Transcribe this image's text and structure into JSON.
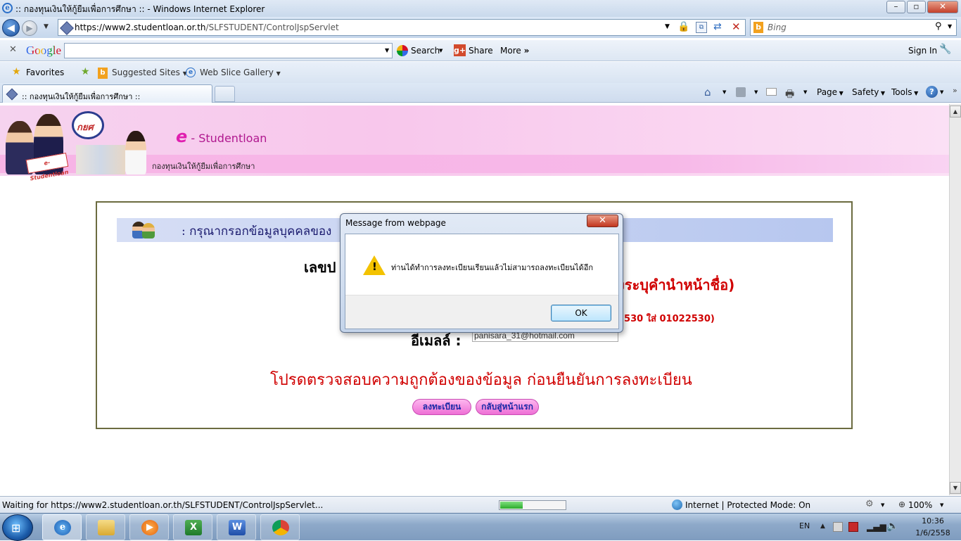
{
  "window": {
    "title": ":: กองทุนเงินให้กู้ยืมเพื่อการศึกษา :: - Windows Internet Explorer"
  },
  "address_bar": {
    "url_domain": "https://www2.studentloan.or.th",
    "url_path": "/SLFSTUDENT/ControlJspServlet",
    "search_placeholder": "Bing"
  },
  "google_toolbar": {
    "logo": "Google",
    "search_label": "Search",
    "share_label": "Share",
    "more_label": "More",
    "signin_label": "Sign In"
  },
  "favorites_bar": {
    "favorites_label": "Favorites",
    "items": [
      "Suggested Sites",
      "Web Slice Gallery"
    ]
  },
  "tabs": [
    {
      "label": ":: กองทุนเงินให้กู้ยืมเพื่อการศึกษา ::"
    }
  ],
  "command_bar": {
    "page": "Page",
    "safety": "Safety",
    "tools": "Tools"
  },
  "banner": {
    "logo_text": "กยศ",
    "title_e": "e",
    "title_rest": "- Studentloan",
    "subtitle": "กองทุนเงินให้กู้ยืมเพื่อการศึกษา",
    "badge": "e-Studentloan"
  },
  "form": {
    "header": ": กรุณากรอกข้อมูลบุคคลของ",
    "id_label_partial": "เลขป",
    "name_hint_partial": "งระบุคำนำหน้าชื่อ)",
    "birthdate_hint_partial": "2530 ใส่ 01022530)",
    "email_label": "อีเมลล์ :",
    "email_value": "panisara_31@hotmail.com",
    "confirm_text": "โปรดตรวจสอบความถูกต้องของข้อมูล ก่อนยืนยันการลงทะเบียน",
    "register_button": "ลงทะเบียน",
    "home_button": "กลับสู่หน้าแรก"
  },
  "dialog": {
    "caption": "Message from webpage",
    "message": "ท่านได้ทำการลงทะเบียนเรียนแล้วไม่สามารถลงทะเบียนได้อีก",
    "ok_label": "OK"
  },
  "status_bar": {
    "text": "Waiting for https://www2.studentloan.or.th/SLFSTUDENT/ControlJspServlet...",
    "progress": 0.34,
    "zone": "Internet | Protected Mode: On",
    "zoom": "100%"
  },
  "taskbar": {
    "language": "EN",
    "time": "10:36",
    "date": "1/6/2558"
  },
  "colors": {
    "banner_pink": "#f8c7ec",
    "form_border": "#6b6b40",
    "alert_red": "#d00000"
  }
}
